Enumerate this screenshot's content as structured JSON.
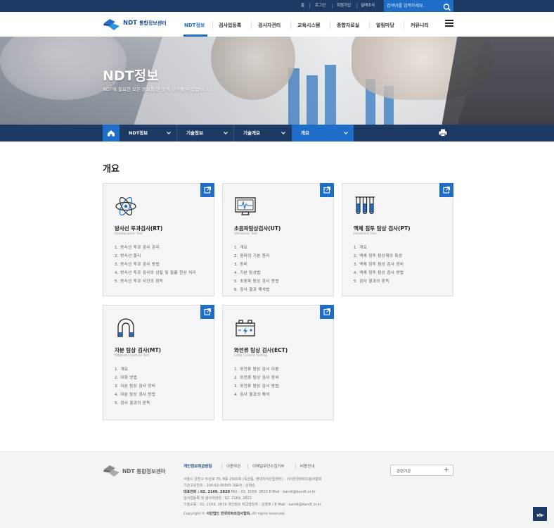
{
  "util": {
    "home": "홈",
    "login": "로그인",
    "join": "회원가입",
    "survey": "실태조사"
  },
  "search": {
    "placeholder": "검색어를 입력하세요."
  },
  "logo": {
    "brand": "NDT",
    "name": "통합정보센터"
  },
  "gnb": [
    "NDT정보",
    "검사업등록",
    "검사자관리",
    "교육시스템",
    "종합자료실",
    "알림마당",
    "커뮤니티"
  ],
  "hero": {
    "title": "NDT정보",
    "subtitle": "NDT에 필요한 모든 정보를 한 곳에 찾아볼 수 있습니다."
  },
  "breadcrumb": [
    "NDT정보",
    "기술정보",
    "기술개요",
    "개요"
  ],
  "page": {
    "title": "개요"
  },
  "cards": [
    {
      "title": "방사선 투과검사(RT)",
      "en": "Radiographic Test",
      "items": [
        "1. 방사선 투과 검사 관리",
        "2. 방사선 물리",
        "3. 방사선 투과 검사 방법",
        "4. 방사선 투과 검사의 상질 및 필름 현상 처리",
        "5. 방사선 투과 사진의 판독"
      ]
    },
    {
      "title": "초음파탐상검사(UT)",
      "en": "Ultrasonic Test",
      "items": [
        "1. 개요",
        "2. 음파의 기본 원리",
        "3. 장비",
        "4. 기본 탐상법",
        "5. 초음파 탐상 검사 방법",
        "6. 검사 결과 해석법"
      ]
    },
    {
      "title": "액체 침투 탐상 검사(PT)",
      "en": "Penetrant Test",
      "items": [
        "1. 개요",
        "2. 액체 침투 탐상재의 특성",
        "3. 액체 침투 탐상 검사 장비",
        "4. 액체 침투 탐상 검사 방법",
        "5. 검사 결과의 판독"
      ]
    },
    {
      "title": "자분 탐상 검사(MT)",
      "en": "Magnetic particle Test",
      "items": [
        "1. 개요",
        "2. 자화 방법",
        "3. 자분 탐상 검사 장비",
        "4. 자분 탐상 검사 방법",
        "5. 검사 결과의 판독"
      ]
    },
    {
      "title": "와전류 탐상 검사(ECT)",
      "en": "Eddy Current Testing",
      "items": [
        "1. 와전류 탐상 검사 이론",
        "2. 와전류 탐상 검사 장비",
        "3. 와전류 탐상 검사 방법",
        "4. 검사 결과의 해석"
      ]
    }
  ],
  "footer": {
    "links": [
      "개인정보취급방침",
      "이용약관",
      "이메일무단수집거부",
      "비용안내"
    ],
    "address": "서울시 금천구 두산로 70, 8동 2301호 (독산동, 현대지식산업센터) , (사)한국비파괴검사협회",
    "bizno": "기관고유번호 : 108-82-06565   대표자 : 손태순",
    "tel_label": "대표전화 : 02. 2169. 2820",
    "fax": "  FAX : 02. 2169. 2822   E-Mail : kandt@kandt.or.kr",
    "line4": "검사업등록 및 검사자관리 : 02. 2169. 2821",
    "line5": "기술교육 : 02. 2169. 2819   개인정보 취급담당자 : 김영주 / E-Mail : kandt@kandt.or.kr",
    "copy_pre": "Copyright © ",
    "copy_org": "사단법인 한국비파괴검사협회.",
    "copy_post": " All rights reserved.",
    "related": "관련기관",
    "top": "TOP"
  }
}
